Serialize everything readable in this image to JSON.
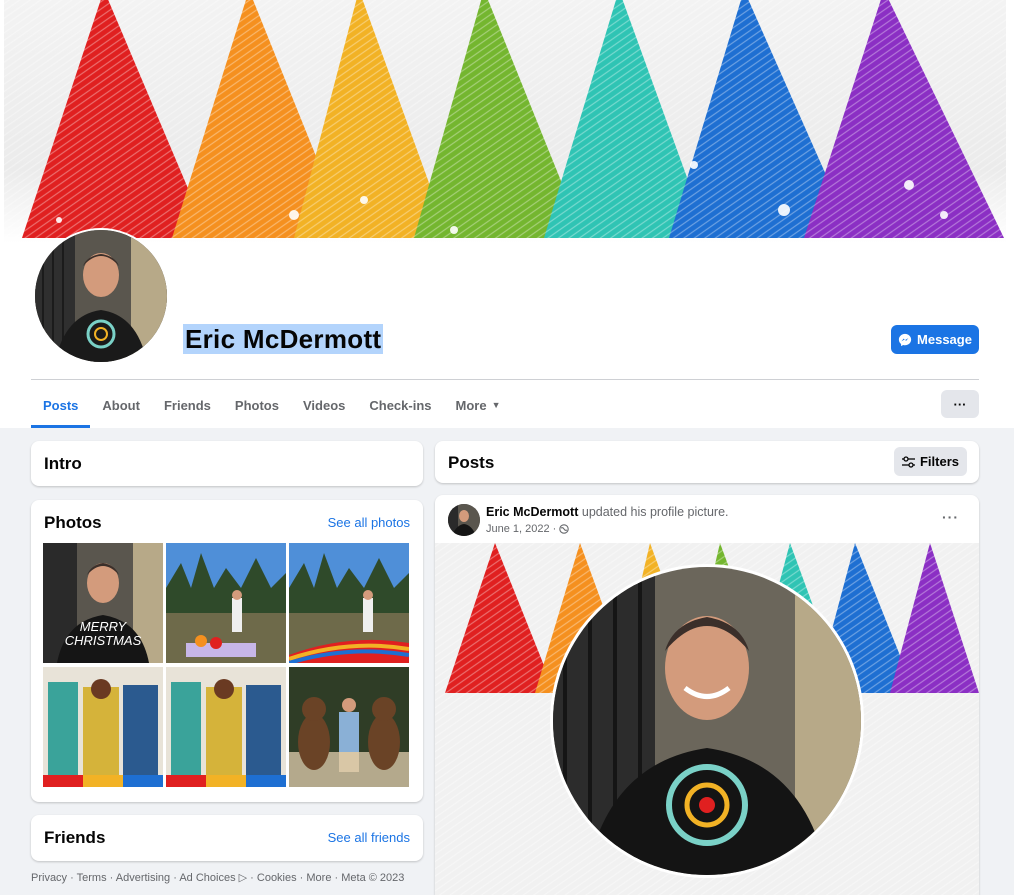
{
  "profile": {
    "name": "Eric McDermott",
    "message_label": "Message"
  },
  "tabs": [
    {
      "label": "Posts"
    },
    {
      "label": "About"
    },
    {
      "label": "Friends"
    },
    {
      "label": "Photos"
    },
    {
      "label": "Videos"
    },
    {
      "label": "Check-ins"
    },
    {
      "label": "More"
    }
  ],
  "more_menu_label": "···",
  "intro": {
    "title": "Intro"
  },
  "photos": {
    "title": "Photos",
    "see_all": "See all photos",
    "tile_text": [
      "MERRY",
      "CHRISTMAS"
    ]
  },
  "friends": {
    "title": "Friends",
    "see_all": "See all friends"
  },
  "footer": "Privacy · Terms · Advertising · Ad Choices ▷ · Cookies · More · Meta © 2023",
  "posts": {
    "title": "Posts",
    "filters_label": "Filters",
    "item": {
      "author": "Eric McDermott",
      "action": "updated his profile picture.",
      "date": "June 1, 2022 ·",
      "more": "···"
    }
  },
  "colors": {
    "accent": "#1b74e4",
    "trees": [
      "#e02020",
      "#f5901f",
      "#f2b225",
      "#74b62f",
      "#2fc4b4",
      "#1e6fd2",
      "#8b2fc4"
    ]
  },
  "icons": {
    "message": "messenger-icon",
    "filters": "sliders-icon",
    "privacy": "globe-icon",
    "more": "caret-down-icon"
  }
}
